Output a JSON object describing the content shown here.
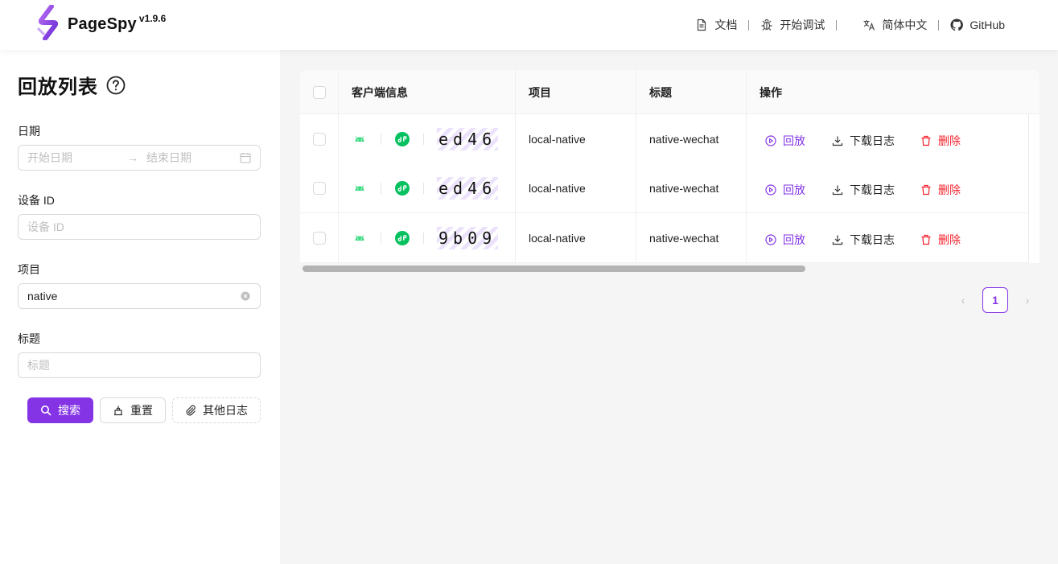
{
  "header": {
    "brand": "PageSpy",
    "version": "v1.9.6",
    "nav": [
      {
        "icon": "document-icon",
        "label": "文档"
      },
      {
        "icon": "bug-icon",
        "label": "开始调试"
      },
      {
        "icon": "translate-icon",
        "label": "简体中文"
      },
      {
        "icon": "github-icon",
        "label": "GitHub"
      }
    ]
  },
  "sidebar": {
    "title": "回放列表",
    "date": {
      "label": "日期",
      "start_placeholder": "开始日期",
      "end_placeholder": "结束日期",
      "separator": "→"
    },
    "device": {
      "label": "设备 ID",
      "placeholder": "设备 ID"
    },
    "project": {
      "label": "项目",
      "value": "native"
    },
    "title_field": {
      "label": "标题",
      "placeholder": "标题"
    },
    "buttons": {
      "search": "搜索",
      "reset": "重置",
      "other_logs": "其他日志"
    }
  },
  "table": {
    "columns": [
      "客户端信息",
      "项目",
      "标题",
      "操作"
    ],
    "rows": [
      {
        "os": "android",
        "client": "mp-wechat",
        "code": "ed46",
        "project": "local-native",
        "title": "native-wechat"
      },
      {
        "os": "android",
        "client": "mp-wechat",
        "code": "ed46",
        "project": "local-native",
        "title": "native-wechat"
      },
      {
        "os": "android",
        "client": "mp-wechat",
        "code": "9b09",
        "project": "local-native",
        "title": "native-wechat"
      }
    ],
    "actions": {
      "replay": "回放",
      "download": "下载日志",
      "delete": "删除"
    }
  },
  "pagination": {
    "current": "1",
    "prev": "‹",
    "next": "›"
  },
  "colors": {
    "accent": "#8434e5",
    "danger": "#f5222d",
    "android": "#3ddc84",
    "wechat": "#07c160"
  }
}
